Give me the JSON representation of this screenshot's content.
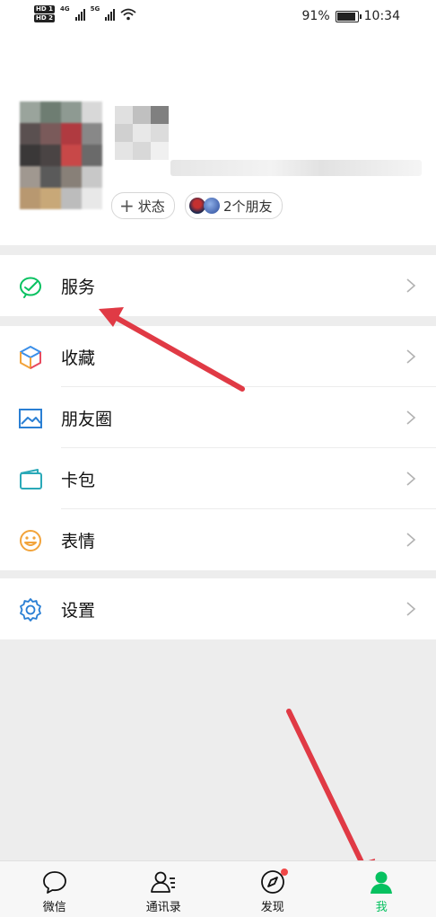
{
  "status_bar": {
    "sim1": "HD 1",
    "sim2": "HD 2",
    "net1": "4G",
    "net2": "5G",
    "battery_text": "91%",
    "battery_level": 0.91,
    "time": "10:34"
  },
  "profile": {
    "status_label": "状态",
    "friends_label": "2个朋友"
  },
  "menu": {
    "services": "服务",
    "favorites": "收藏",
    "moments": "朋友圈",
    "cards": "卡包",
    "stickers": "表情",
    "settings": "设置"
  },
  "tabs": [
    {
      "label": "微信",
      "icon": "chat-icon"
    },
    {
      "label": "通讯录",
      "icon": "contacts-icon"
    },
    {
      "label": "发现",
      "icon": "compass-icon",
      "badge": "red-dot"
    },
    {
      "label": "我",
      "icon": "person-icon",
      "active": true
    }
  ],
  "colors": {
    "accent_green": "#07c160",
    "annotation_red": "#e03a45",
    "background": "#ededed"
  }
}
